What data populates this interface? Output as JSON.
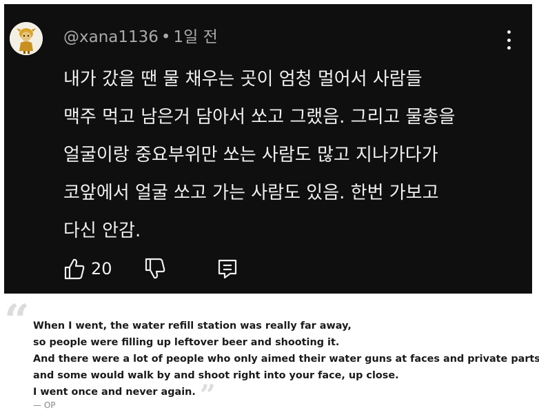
{
  "comment": {
    "username": "@xana1136",
    "separator": "•",
    "time": "1일 전",
    "lines": [
      "내가 갔을 땐 물 채우는 곳이 엄청 멀어서 사람들",
      "맥주 먹고 남은거 담아서 쏘고 그랬음. 그리고 물총을",
      "얼굴이랑 중요부위만 쏘는 사람도 많고 지나가다가",
      "코앞에서 얼굴 쏘고 가는 사람도 있음. 한번 가보고",
      "다신 안감."
    ],
    "like_count": "20",
    "icons": {
      "avatar": "cartoon-avatar",
      "menu": "kebab-menu-icon",
      "like": "thumbs-up-icon",
      "dislike": "thumbs-down-icon",
      "reply": "reply-comment-icon"
    },
    "colors": {
      "background": "#0f0f0f",
      "text": "#f1f1f1",
      "meta": "#aaaaaa"
    }
  },
  "translation": {
    "lines": [
      "When I went, the water refill station was really far away,",
      "so people were filling up leftover beer and shooting it.",
      "And there were a lot of people who only aimed their water guns at faces and private parts,",
      "and some would walk by and shoot right into your face, up close.",
      "I went once and never again."
    ],
    "attribution": "— OP"
  }
}
